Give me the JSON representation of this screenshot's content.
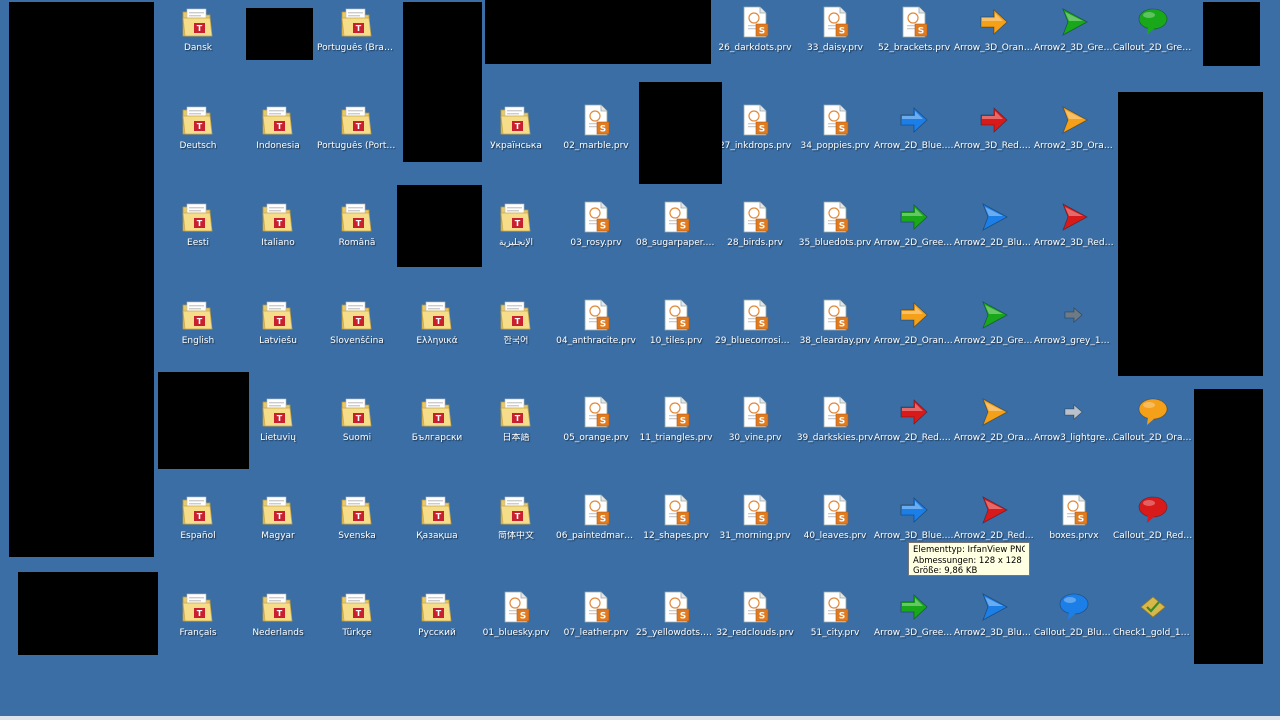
{
  "desktop": {
    "items": [
      {
        "label": "Dansk",
        "icon": "folder-icon",
        "col": 0,
        "row": 0
      },
      {
        "label": "Deutsch",
        "icon": "folder-icon",
        "col": 0,
        "row": 1
      },
      {
        "label": "Eesti",
        "icon": "folder-icon",
        "col": 0,
        "row": 2
      },
      {
        "label": "English",
        "icon": "folder-icon",
        "col": 0,
        "row": 3
      },
      {
        "label": "Español",
        "icon": "folder-icon",
        "col": 0,
        "row": 5
      },
      {
        "label": "Français",
        "icon": "folder-icon",
        "col": 0,
        "row": 6
      },
      {
        "label": "Indonesia",
        "icon": "folder-icon",
        "col": 1,
        "row": 1
      },
      {
        "label": "Italiano",
        "icon": "folder-icon",
        "col": 1,
        "row": 2
      },
      {
        "label": "Latviešu",
        "icon": "folder-icon",
        "col": 1,
        "row": 3
      },
      {
        "label": "Lietuvių",
        "icon": "folder-icon",
        "col": 1,
        "row": 4
      },
      {
        "label": "Magyar",
        "icon": "folder-icon",
        "col": 1,
        "row": 5
      },
      {
        "label": "Nederlands",
        "icon": "folder-icon",
        "col": 1,
        "row": 6
      },
      {
        "label": "Português (Brasil)",
        "icon": "folder-icon",
        "col": 2,
        "row": 0
      },
      {
        "label": "Português (Portugal)",
        "icon": "folder-icon",
        "col": 2,
        "row": 1
      },
      {
        "label": "Română",
        "icon": "folder-icon",
        "col": 2,
        "row": 2
      },
      {
        "label": "Slovenščina",
        "icon": "folder-icon",
        "col": 2,
        "row": 3
      },
      {
        "label": "Suomi",
        "icon": "folder-icon",
        "col": 2,
        "row": 4
      },
      {
        "label": "Svenska",
        "icon": "folder-icon",
        "col": 2,
        "row": 5
      },
      {
        "label": "Türkçe",
        "icon": "folder-icon",
        "col": 2,
        "row": 6
      },
      {
        "label": "Ελληνικά",
        "icon": "folder-icon",
        "col": 3,
        "row": 3
      },
      {
        "label": "Български",
        "icon": "folder-icon",
        "col": 3,
        "row": 4
      },
      {
        "label": "Қазақша",
        "icon": "folder-icon",
        "col": 3,
        "row": 5
      },
      {
        "label": "Русский",
        "icon": "folder-icon",
        "col": 3,
        "row": 6
      },
      {
        "label": "Українська",
        "icon": "folder-icon",
        "col": 4,
        "row": 1
      },
      {
        "label": "الإنجليزية",
        "icon": "folder-icon",
        "col": 4,
        "row": 2
      },
      {
        "label": "한국어",
        "icon": "folder-icon",
        "col": 4,
        "row": 3
      },
      {
        "label": "日本語",
        "icon": "folder-icon",
        "col": 4,
        "row": 4
      },
      {
        "label": "简体中文",
        "icon": "folder-icon",
        "col": 4,
        "row": 5
      },
      {
        "label": "01_bluesky.prv",
        "icon": "prv-file-icon",
        "col": 4,
        "row": 6
      },
      {
        "label": "02_marble.prv",
        "icon": "prv-file-icon",
        "col": 5,
        "row": 1
      },
      {
        "label": "03_rosy.prv",
        "icon": "prv-file-icon",
        "col": 5,
        "row": 2
      },
      {
        "label": "04_anthracite.prv",
        "icon": "prv-file-icon",
        "col": 5,
        "row": 3
      },
      {
        "label": "05_orange.prv",
        "icon": "prv-file-icon",
        "col": 5,
        "row": 4
      },
      {
        "label": "06_paintedmarble....",
        "icon": "prv-file-icon",
        "col": 5,
        "row": 5
      },
      {
        "label": "07_leather.prv",
        "icon": "prv-file-icon",
        "col": 5,
        "row": 6
      },
      {
        "label": "08_sugarpaper.prv",
        "icon": "prv-file-icon",
        "col": 6,
        "row": 2
      },
      {
        "label": "10_tiles.prv",
        "icon": "prv-file-icon",
        "col": 6,
        "row": 3
      },
      {
        "label": "11_triangles.prv",
        "icon": "prv-file-icon",
        "col": 6,
        "row": 4
      },
      {
        "label": "12_shapes.prv",
        "icon": "prv-file-icon",
        "col": 6,
        "row": 5
      },
      {
        "label": "25_yellowdots.prv",
        "icon": "prv-file-icon",
        "col": 6,
        "row": 6
      },
      {
        "label": "26_darkdots.prv",
        "icon": "prv-file-icon",
        "col": 7,
        "row": 0
      },
      {
        "label": "27_inkdrops.prv",
        "icon": "prv-file-icon",
        "col": 7,
        "row": 1
      },
      {
        "label": "28_birds.prv",
        "icon": "prv-file-icon",
        "col": 7,
        "row": 2
      },
      {
        "label": "29_bluecorrosion.prv",
        "icon": "prv-file-icon",
        "col": 7,
        "row": 3
      },
      {
        "label": "30_vine.prv",
        "icon": "prv-file-icon",
        "col": 7,
        "row": 4
      },
      {
        "label": "31_morning.prv",
        "icon": "prv-file-icon",
        "col": 7,
        "row": 5
      },
      {
        "label": "32_redclouds.prv",
        "icon": "prv-file-icon",
        "col": 7,
        "row": 6
      },
      {
        "label": "33_daisy.prv",
        "icon": "prv-file-icon",
        "col": 8,
        "row": 0
      },
      {
        "label": "34_poppies.prv",
        "icon": "prv-file-icon",
        "col": 8,
        "row": 1
      },
      {
        "label": "35_bluedots.prv",
        "icon": "prv-file-icon",
        "col": 8,
        "row": 2
      },
      {
        "label": "38_clearday.prv",
        "icon": "prv-file-icon",
        "col": 8,
        "row": 3
      },
      {
        "label": "39_darkskies.prv",
        "icon": "prv-file-icon",
        "col": 8,
        "row": 4
      },
      {
        "label": "40_leaves.prv",
        "icon": "prv-file-icon",
        "col": 8,
        "row": 5
      },
      {
        "label": "51_city.prv",
        "icon": "prv-file-icon",
        "col": 8,
        "row": 6
      },
      {
        "label": "52_brackets.prv",
        "icon": "prv-file-icon",
        "col": 9,
        "row": 0
      },
      {
        "label": "Arrow_2D_Blue.png",
        "icon": "arrow-2d-blue-icon",
        "col": 9,
        "row": 1
      },
      {
        "label": "Arrow_2D_Green....",
        "icon": "arrow-2d-green-icon",
        "col": 9,
        "row": 2
      },
      {
        "label": "Arrow_2D_Orang....",
        "icon": "arrow-2d-orange-icon",
        "col": 9,
        "row": 3
      },
      {
        "label": "Arrow_2D_Red.png",
        "icon": "arrow-2d-red-icon",
        "col": 9,
        "row": 4
      },
      {
        "label": "Arrow_3D_Blue.png",
        "icon": "arrow-3d-blue-icon",
        "col": 9,
        "row": 5
      },
      {
        "label": "Arrow_3D_Green....",
        "icon": "arrow-3d-green-icon",
        "col": 9,
        "row": 6
      },
      {
        "label": "Arrow_3D_Orang....",
        "icon": "arrow-3d-orange-icon",
        "col": 10,
        "row": 0
      },
      {
        "label": "Arrow_3D_Red.png",
        "icon": "arrow-3d-red-icon",
        "col": 10,
        "row": 1
      },
      {
        "label": "Arrow2_2D_Blue....",
        "icon": "arrow2-2d-blue-icon",
        "col": 10,
        "row": 2
      },
      {
        "label": "Arrow2_2D_Gree....",
        "icon": "arrow2-2d-green-icon",
        "col": 10,
        "row": 3
      },
      {
        "label": "Arrow2_2D_Oran....",
        "icon": "arrow2-2d-orange-icon",
        "col": 10,
        "row": 4
      },
      {
        "label": "Arrow2_2D_Red.png",
        "icon": "arrow2-2d-red-icon",
        "col": 10,
        "row": 5
      },
      {
        "label": "Arrow2_3D_Blue....",
        "icon": "arrow2-3d-blue-icon",
        "col": 10,
        "row": 6
      },
      {
        "label": "Arrow2_3D_Gree....",
        "icon": "arrow2-3d-green-icon",
        "col": 11,
        "row": 0
      },
      {
        "label": "Arrow2_3D_Oran....",
        "icon": "arrow2-3d-orange-icon",
        "col": 11,
        "row": 1
      },
      {
        "label": "Arrow2_3D_Red.png",
        "icon": "arrow2-3d-red-icon",
        "col": 11,
        "row": 2
      },
      {
        "label": "Arrow3_grey_128....",
        "icon": "arrow3-grey-icon",
        "col": 11,
        "row": 3
      },
      {
        "label": "Arrow3_lightgrey_....",
        "icon": "arrow3-lightgrey-icon",
        "col": 11,
        "row": 4
      },
      {
        "label": "boxes.prvx",
        "icon": "prv-file-icon",
        "col": 11,
        "row": 5
      },
      {
        "label": "Callout_2D_Blue.png",
        "icon": "callout-2d-blue-icon",
        "col": 11,
        "row": 6
      },
      {
        "label": "Callout_2D_Gree....",
        "icon": "callout-2d-green-icon",
        "col": 12,
        "row": 0
      },
      {
        "label": "Callout_2D_Oran....",
        "icon": "callout-2d-orange-icon",
        "col": 12,
        "row": 4
      },
      {
        "label": "Callout_2D_Red.png",
        "icon": "callout-2d-red-icon",
        "col": 12,
        "row": 5
      },
      {
        "label": "Check1_gold_128....",
        "icon": "check-gold-icon",
        "col": 12,
        "row": 6
      }
    ]
  },
  "tooltip": {
    "line1": "Elementtyp: IrfanView PNG File",
    "line2": "Abmessungen: 128 x 128",
    "line3": "Größe: 9,86 KB"
  },
  "colors": {
    "desktop": "#3a6ea5",
    "blue": "#1c7fe8",
    "green": "#18a81a",
    "orange": "#f5a019",
    "red": "#d81a1a",
    "grey": "#6d7b88",
    "lightgrey": "#b9c2cc"
  }
}
